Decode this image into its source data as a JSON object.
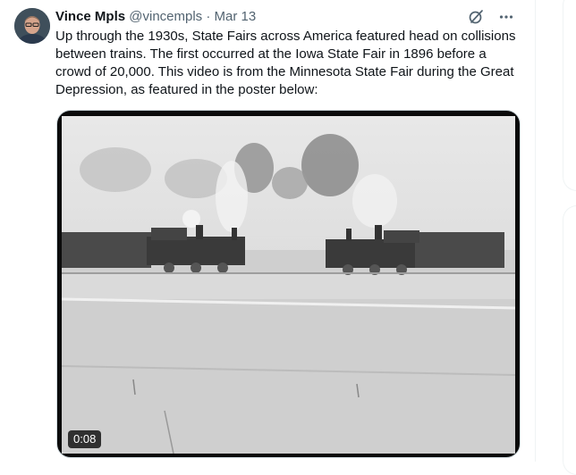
{
  "tweet": {
    "author_name": "Vince Mpls",
    "author_handle": "@vincempls",
    "separator": "·",
    "date": "Mar 13",
    "text": "Up through the 1930s, State Fairs across America featured head on collisions between trains. The first occurred at the Iowa State Fair in 1896 before a crowd of 20,000. This video is from the Minnesota State Fair during the Great Depression, as featured in the poster below:",
    "media": {
      "duration": "0:08"
    },
    "icons": {
      "grok": "grok-icon",
      "more": "more-icon"
    }
  },
  "colors": {
    "text_primary": "#0f1419",
    "text_secondary": "#536471",
    "border": "#eff3f4"
  }
}
